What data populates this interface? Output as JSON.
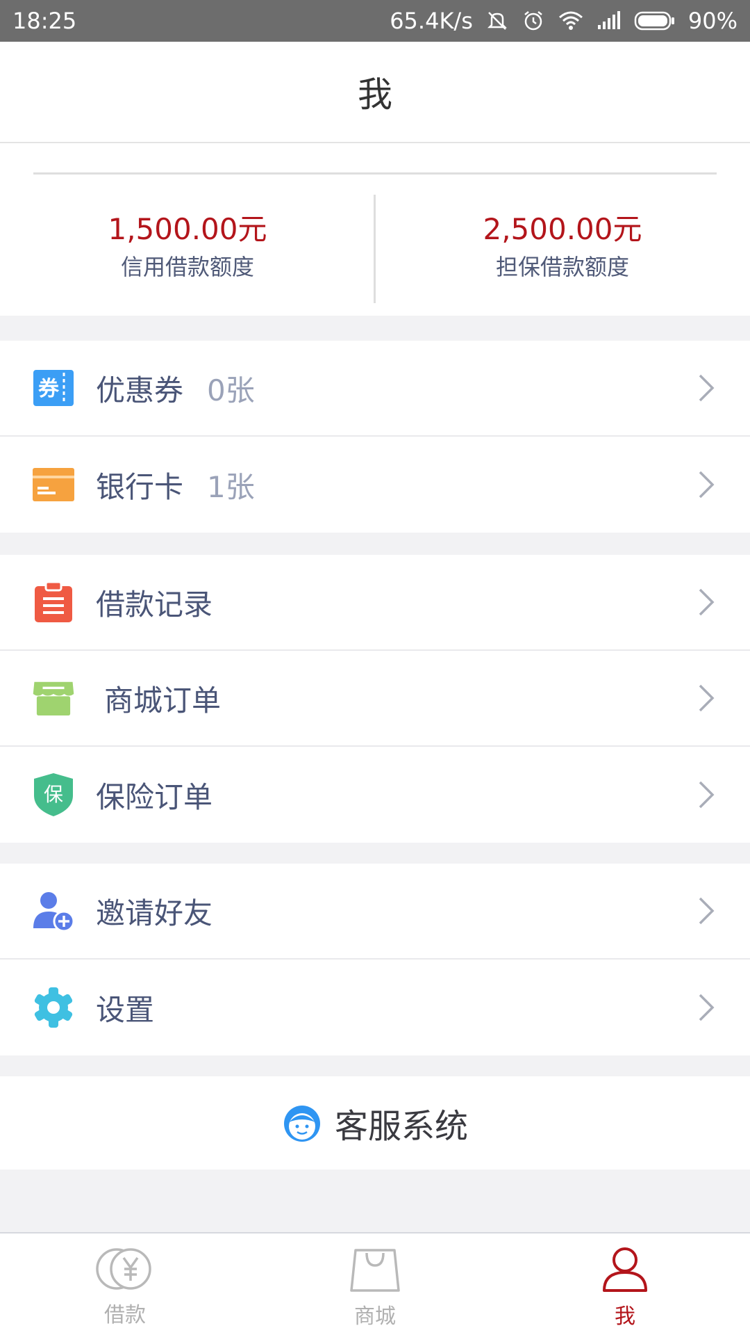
{
  "status_bar": {
    "time": "18:25",
    "network_speed": "65.4K/s",
    "battery": "90%",
    "icons": [
      "mute-icon",
      "alarm-icon",
      "wifi-icon",
      "signal-icon",
      "battery-icon"
    ]
  },
  "header": {
    "title": "我"
  },
  "credit": {
    "left": {
      "amount": "1,500.00元",
      "label": "信用借款额度"
    },
    "right": {
      "amount": "2,500.00元",
      "label": "担保借款额度"
    }
  },
  "menu": {
    "coupon": {
      "label": "优惠券",
      "count": "0张",
      "icon": "coupon-icon"
    },
    "bank_card": {
      "label": "银行卡",
      "count": "1张",
      "icon": "bank-card-icon"
    },
    "loan_records": {
      "label": "借款记录",
      "icon": "clipboard-icon"
    },
    "mall_orders": {
      "label": "商城订单",
      "icon": "shop-icon"
    },
    "insurance_orders": {
      "label": "保险订单",
      "icon": "shield-icon",
      "icon_text": "保"
    },
    "invite_friends": {
      "label": "邀请好友",
      "icon": "add-user-icon"
    },
    "settings": {
      "label": "设置",
      "icon": "gear-icon"
    }
  },
  "customer_service": {
    "label": "客服系统",
    "icon": "support-agent-icon"
  },
  "tabs": [
    {
      "label": "借款",
      "icon": "yen-coin-icon",
      "active": false
    },
    {
      "label": "商城",
      "icon": "shopping-bag-icon",
      "active": false
    },
    {
      "label": "我",
      "icon": "user-icon",
      "active": true
    }
  ],
  "colors": {
    "accent": "#b3151b",
    "coupon": "#3b9ef5",
    "bank_card": "#f6a23f",
    "clipboard": "#ef5a43",
    "shop": "#9fd36f",
    "shield": "#45bd8c",
    "invite": "#5b7de8",
    "gear": "#3fc0e2",
    "service": "#2f95f2"
  }
}
